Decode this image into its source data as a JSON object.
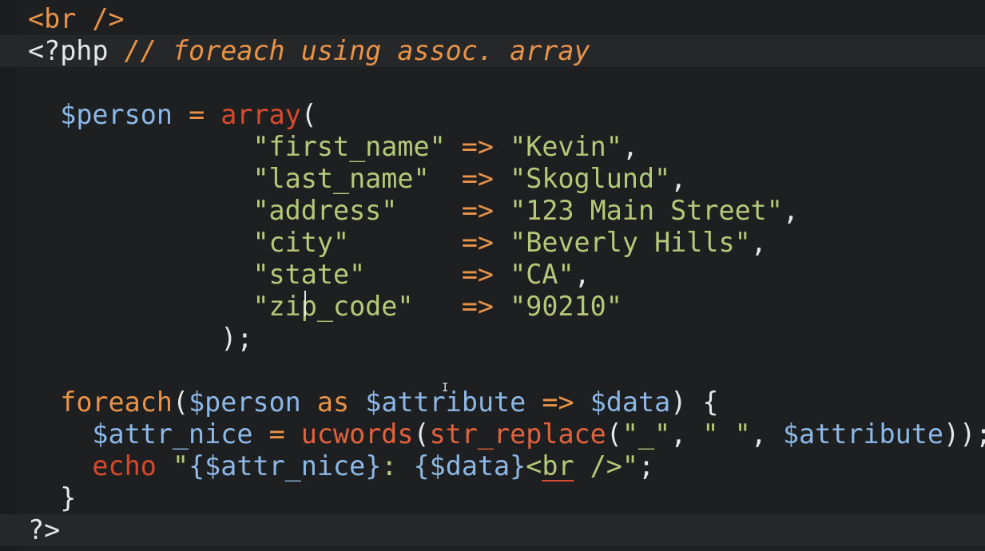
{
  "editor": {
    "lines": [
      {
        "tokens": [
          {
            "t": "<br />",
            "c": "tag"
          }
        ]
      },
      {
        "tokens": [
          {
            "t": "<?php ",
            "c": "php-tag"
          },
          {
            "t": "// foreach using assoc. array",
            "c": "cm"
          }
        ]
      },
      {
        "tokens": []
      },
      {
        "tokens": [
          {
            "t": "  "
          },
          {
            "t": "$person",
            "c": "var"
          },
          {
            "t": " "
          },
          {
            "t": "=",
            "c": "op"
          },
          {
            "t": " "
          },
          {
            "t": "array",
            "c": "fnred"
          },
          {
            "t": "(",
            "c": "plain"
          }
        ]
      },
      {
        "tokens": [
          {
            "t": "              "
          },
          {
            "t": "\"first_name\"",
            "c": "str"
          },
          {
            "t": " "
          },
          {
            "t": "=>",
            "c": "op"
          },
          {
            "t": " "
          },
          {
            "t": "\"Kevin\"",
            "c": "str"
          },
          {
            "t": ",",
            "c": "plain"
          }
        ]
      },
      {
        "tokens": [
          {
            "t": "              "
          },
          {
            "t": "\"last_name\"",
            "c": "str"
          },
          {
            "t": "  "
          },
          {
            "t": "=>",
            "c": "op"
          },
          {
            "t": " "
          },
          {
            "t": "\"Skoglund\"",
            "c": "str"
          },
          {
            "t": ",",
            "c": "plain"
          }
        ]
      },
      {
        "tokens": [
          {
            "t": "              "
          },
          {
            "t": "\"address\"",
            "c": "str"
          },
          {
            "t": "    "
          },
          {
            "t": "=>",
            "c": "op"
          },
          {
            "t": " "
          },
          {
            "t": "\"123 Main Street\"",
            "c": "str"
          },
          {
            "t": ",",
            "c": "plain"
          }
        ]
      },
      {
        "tokens": [
          {
            "t": "              "
          },
          {
            "t": "\"city\"",
            "c": "str"
          },
          {
            "t": "       "
          },
          {
            "t": "=>",
            "c": "op"
          },
          {
            "t": " "
          },
          {
            "t": "\"Beverly Hills\"",
            "c": "str"
          },
          {
            "t": ",",
            "c": "plain"
          }
        ]
      },
      {
        "tokens": [
          {
            "t": "              "
          },
          {
            "t": "\"state\"",
            "c": "str"
          },
          {
            "t": "      "
          },
          {
            "t": "=>",
            "c": "op"
          },
          {
            "t": " "
          },
          {
            "t": "\"CA\"",
            "c": "str"
          },
          {
            "t": ",",
            "c": "plain"
          }
        ]
      },
      {
        "tokens": [
          {
            "t": "              "
          },
          {
            "t": "\"zip_code\"",
            "c": "str"
          },
          {
            "t": "   "
          },
          {
            "t": "=>",
            "c": "op"
          },
          {
            "t": " "
          },
          {
            "t": "\"90210\"",
            "c": "str"
          }
        ]
      },
      {
        "tokens": [
          {
            "t": "            "
          },
          {
            "t": ");",
            "c": "plain"
          }
        ]
      },
      {
        "tokens": []
      },
      {
        "tokens": [
          {
            "t": "  "
          },
          {
            "t": "foreach",
            "c": "kw"
          },
          {
            "t": "(",
            "c": "plain"
          },
          {
            "t": "$person",
            "c": "var"
          },
          {
            "t": " "
          },
          {
            "t": "as",
            "c": "kw"
          },
          {
            "t": " "
          },
          {
            "t": "$attribute",
            "c": "var"
          },
          {
            "t": " "
          },
          {
            "t": "=>",
            "c": "op"
          },
          {
            "t": " "
          },
          {
            "t": "$data",
            "c": "var"
          },
          {
            "t": ") {",
            "c": "plain"
          }
        ]
      },
      {
        "tokens": [
          {
            "t": "    "
          },
          {
            "t": "$attr_nice",
            "c": "var"
          },
          {
            "t": " "
          },
          {
            "t": "=",
            "c": "op"
          },
          {
            "t": " "
          },
          {
            "t": "ucwords",
            "c": "fn"
          },
          {
            "t": "(",
            "c": "plain"
          },
          {
            "t": "str_replace",
            "c": "fn"
          },
          {
            "t": "(",
            "c": "plain"
          },
          {
            "t": "\"_\"",
            "c": "str"
          },
          {
            "t": ", ",
            "c": "plain"
          },
          {
            "t": "\" \"",
            "c": "str"
          },
          {
            "t": ", ",
            "c": "plain"
          },
          {
            "t": "$attribute",
            "c": "var"
          },
          {
            "t": "));",
            "c": "plain"
          }
        ]
      },
      {
        "tokens": [
          {
            "t": "    "
          },
          {
            "t": "echo",
            "c": "fnred"
          },
          {
            "t": " "
          },
          {
            "t": "\"",
            "c": "str"
          },
          {
            "t": "{$attr_nice}",
            "c": "var"
          },
          {
            "t": ": ",
            "c": "str"
          },
          {
            "t": "{$data}",
            "c": "var"
          },
          {
            "t": "<",
            "c": "str"
          },
          {
            "t": "br",
            "c": "str squiggle"
          },
          {
            "t": " />\"",
            "c": "str"
          },
          {
            "t": ";",
            "c": "plain"
          }
        ]
      },
      {
        "tokens": [
          {
            "t": "  "
          },
          {
            "t": "}",
            "c": "plain"
          }
        ]
      },
      {
        "tokens": [
          {
            "t": "?>",
            "c": "php-tag"
          }
        ]
      }
    ]
  }
}
